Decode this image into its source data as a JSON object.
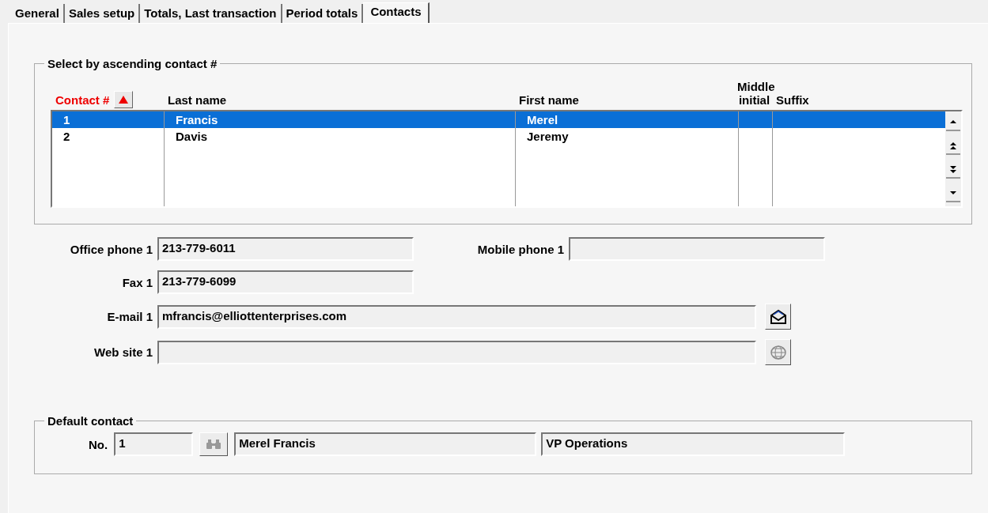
{
  "tabs": [
    {
      "label": "General",
      "selected": false
    },
    {
      "label": "Sales setup",
      "selected": false
    },
    {
      "label": "Totals, Last transaction",
      "selected": false
    },
    {
      "label": "Period totals",
      "selected": false
    },
    {
      "label": "Contacts",
      "selected": true
    }
  ],
  "contacts_group": {
    "title": "Select by ascending contact #",
    "columns": [
      {
        "label": "Contact #",
        "sorted": true
      },
      {
        "label": "Last name",
        "sorted": false
      },
      {
        "label": "First name",
        "sorted": false
      },
      {
        "label": "Middle initial",
        "sorted": false
      },
      {
        "label": "Suffix",
        "sorted": false
      }
    ],
    "rows": [
      {
        "cells": [
          "1",
          "Francis",
          "Merel",
          null,
          null
        ],
        "selected": true
      },
      {
        "cells": [
          "2",
          "Davis",
          "Jeremy",
          null,
          null
        ],
        "selected": false
      }
    ]
  },
  "details": {
    "office_phone": {
      "label": "Office phone 1",
      "value": "213-779-6011"
    },
    "mobile_phone": {
      "label": "Mobile phone 1"
    },
    "fax": {
      "label": "Fax 1",
      "value": "213-779-6099"
    },
    "email": {
      "label": "E-mail 1",
      "value": "mfrancis@elliottenterprises.com"
    },
    "web_site": {
      "label": "Web site 1"
    }
  },
  "default_contact": {
    "title": "Default contact",
    "label": "No.",
    "number": "1",
    "name": "Merel Francis",
    "position": "VP Operations"
  }
}
